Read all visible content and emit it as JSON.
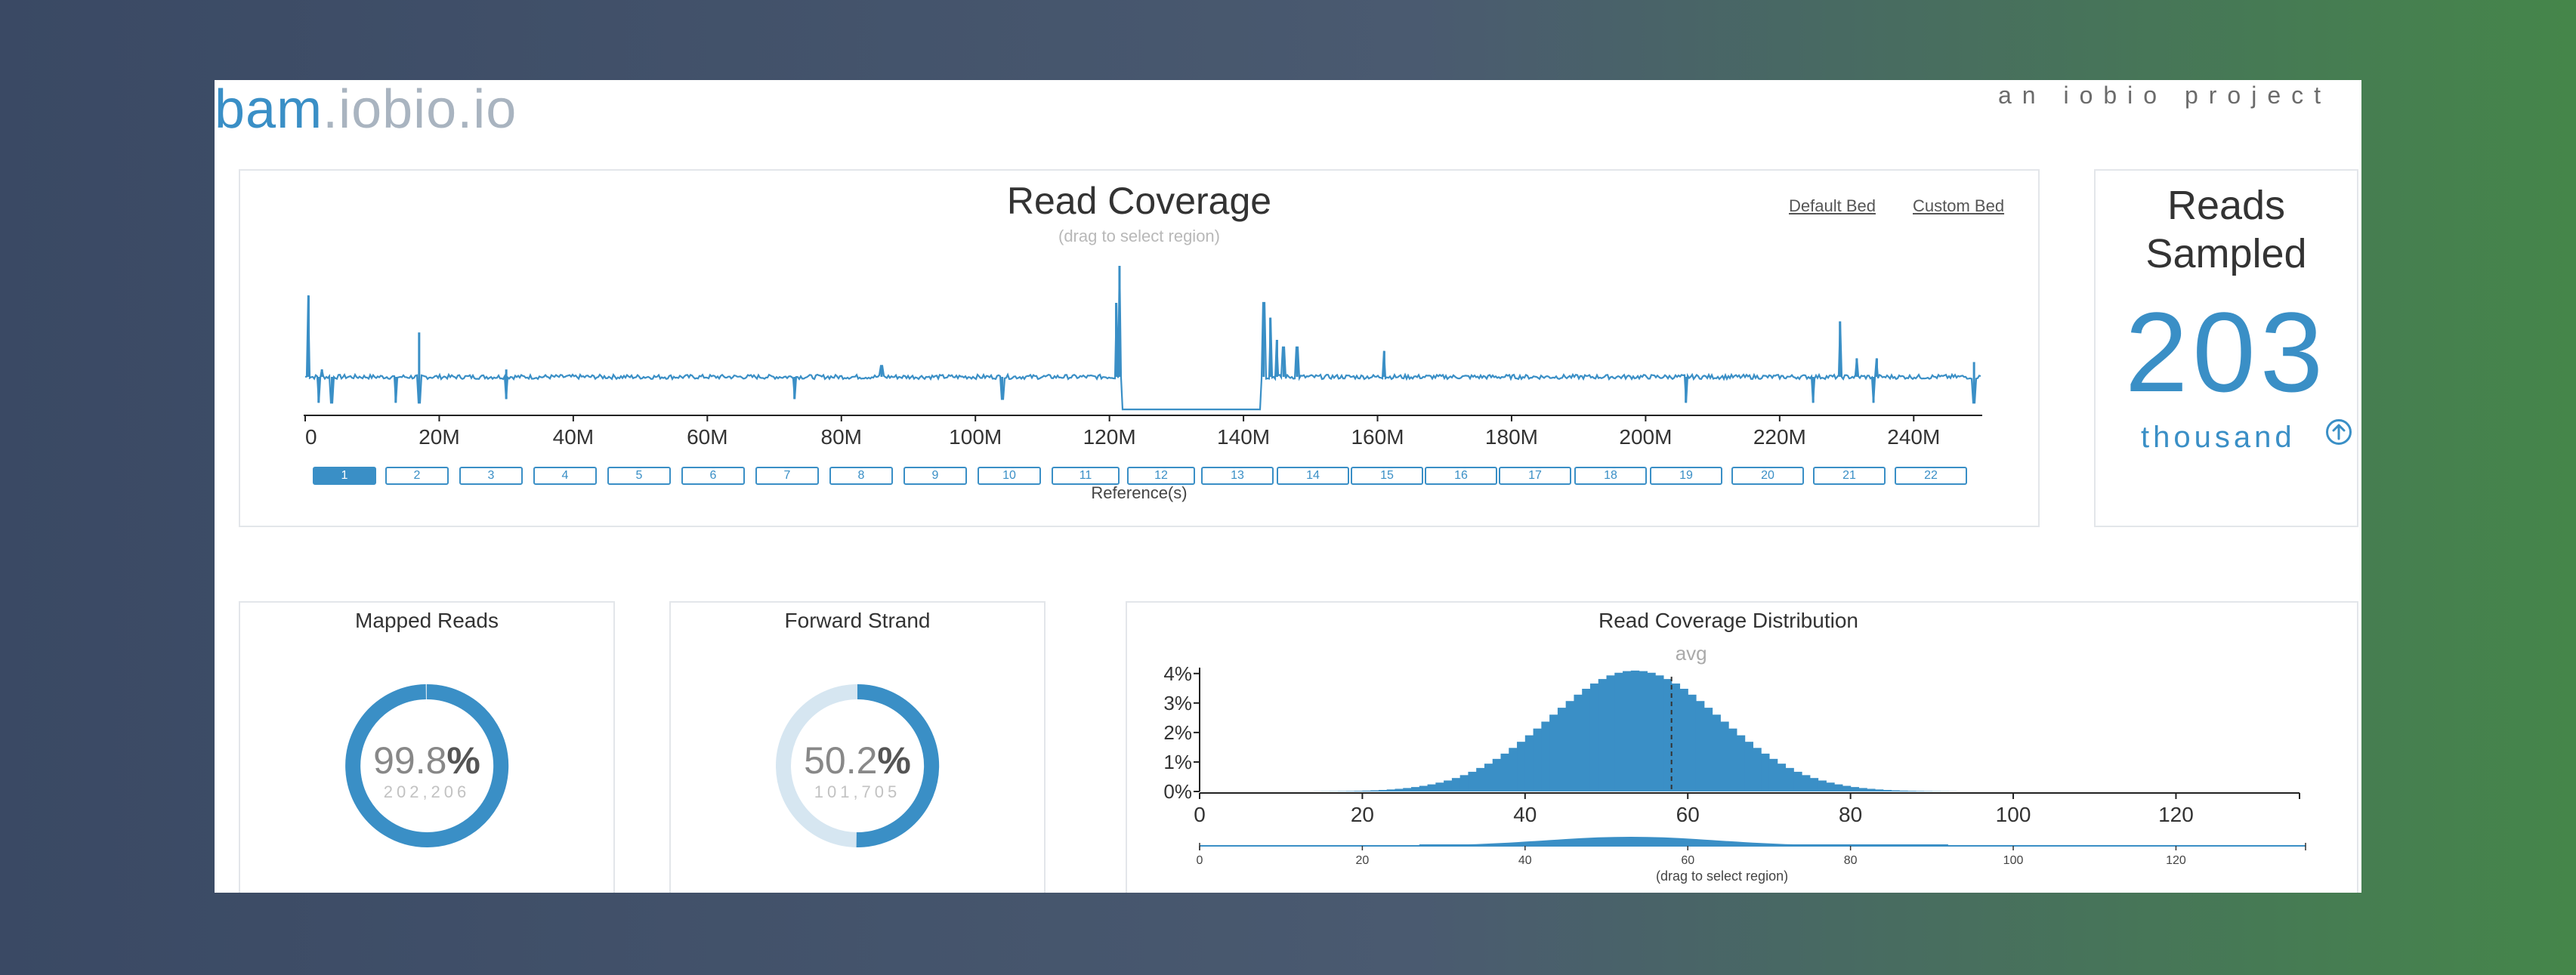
{
  "brand": {
    "part1": "bam",
    "part2": ".iobio.io",
    "tagline": "an iobio project"
  },
  "coverage": {
    "title": "Read Coverage",
    "subtitle": "(drag to select region)",
    "default_bed": "Default Bed",
    "custom_bed": "Custom Bed",
    "references_label": "Reference(s)",
    "references": [
      "1",
      "2",
      "3",
      "4",
      "5",
      "6",
      "7",
      "8",
      "9",
      "10",
      "11",
      "12",
      "13",
      "14",
      "15",
      "16",
      "17",
      "18",
      "19",
      "20",
      "21",
      "22"
    ],
    "active_reference": "1"
  },
  "reads_sampled": {
    "title_line1": "Reads",
    "title_line2": "Sampled",
    "value": "203",
    "unit": "thousand"
  },
  "mapped_reads": {
    "title": "Mapped Reads",
    "percent": "99.8",
    "symbol": "%",
    "count": "202,206",
    "fraction": 0.998
  },
  "forward_strand": {
    "title": "Forward Strand",
    "percent": "50.2",
    "symbol": "%",
    "count": "101,705",
    "fraction": 0.502
  },
  "colors": {
    "accent": "#3a8fc6",
    "light_accent": "#d6e6f1",
    "panel_border": "#e3e6ea"
  },
  "chart_data": [
    {
      "type": "line",
      "title": "Read Coverage",
      "xlabel": "Reference(s)",
      "x_ticks": [
        "0",
        "20M",
        "40M",
        "60M",
        "80M",
        "100M",
        "120M",
        "140M",
        "160M",
        "180M",
        "200M",
        "220M",
        "240M"
      ],
      "xlim": [
        0,
        250000000
      ],
      "ylim": [
        0,
        4
      ],
      "baseline": 1,
      "spikes": [
        {
          "x": 500000,
          "y": 3.2
        },
        {
          "x": 2500000,
          "y": 1.2
        },
        {
          "x": 17000000,
          "y": 2.2
        },
        {
          "x": 30000000,
          "y": 1.2
        },
        {
          "x": 86000000,
          "y": 1.3
        },
        {
          "x": 121000000,
          "y": 3.0
        },
        {
          "x": 121500000,
          "y": 4.0
        },
        {
          "x": 143000000,
          "y": 3.0
        },
        {
          "x": 144000000,
          "y": 2.6
        },
        {
          "x": 145000000,
          "y": 2.0
        },
        {
          "x": 146000000,
          "y": 1.8
        },
        {
          "x": 148000000,
          "y": 1.8
        },
        {
          "x": 161000000,
          "y": 1.7
        },
        {
          "x": 229000000,
          "y": 2.5
        },
        {
          "x": 231500000,
          "y": 1.5
        },
        {
          "x": 234500000,
          "y": 1.5
        },
        {
          "x": 249000000,
          "y": 1.4
        }
      ],
      "dips": [
        {
          "x": 2000000,
          "y": 0.3
        },
        {
          "x": 4000000,
          "y": 0.3
        },
        {
          "x": 13500000,
          "y": 0.3
        },
        {
          "x": 17000000,
          "y": 0.3
        },
        {
          "x": 30000000,
          "y": 0.4
        },
        {
          "x": 73000000,
          "y": 0.4
        },
        {
          "x": 104000000,
          "y": 0.4
        },
        {
          "x": 206000000,
          "y": 0.3
        },
        {
          "x": 225000000,
          "y": 0.3
        },
        {
          "x": 234000000,
          "y": 0.3
        },
        {
          "x": 249000000,
          "y": 0.3
        }
      ],
      "gap": [
        121800000,
        142500000
      ]
    },
    {
      "type": "bar",
      "title": "Read Coverage Distribution",
      "subtitle": "(drag to select region)",
      "annotation": "avg",
      "avg": 58,
      "x_ticks": [
        0,
        20,
        40,
        60,
        80,
        100,
        120
      ],
      "y_ticks": [
        "0%",
        "1%",
        "2%",
        "3%",
        "4%"
      ],
      "xlim": [
        0,
        135
      ],
      "ylim": [
        0,
        4.2
      ],
      "mean": 53,
      "sd": 10.5,
      "peak_percent": 4.1,
      "tail_to": 108
    }
  ]
}
